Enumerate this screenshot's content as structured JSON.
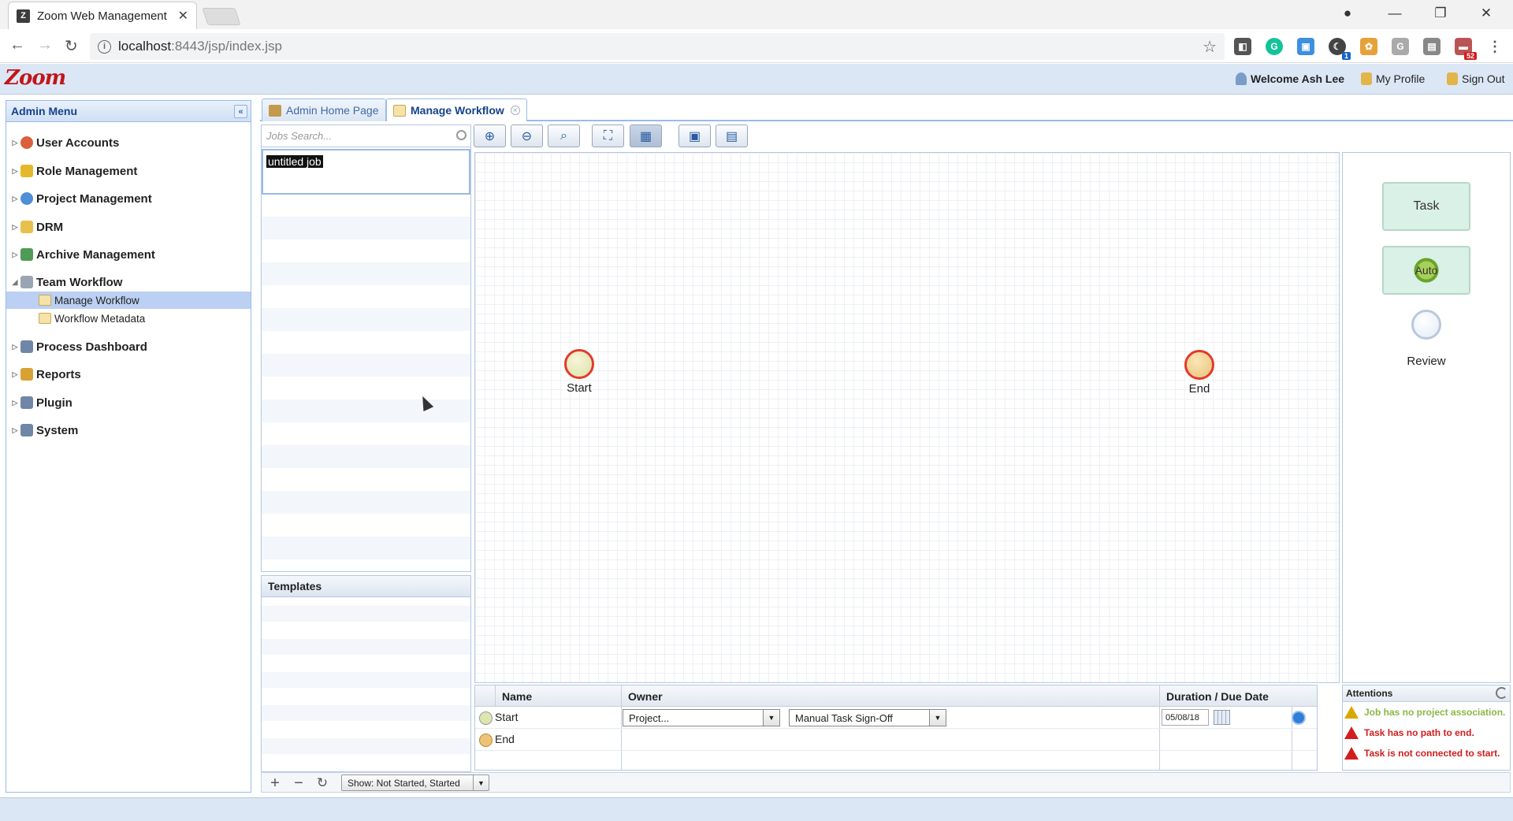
{
  "browser": {
    "tab_title": "Zoom Web Management",
    "favicon": "Z",
    "url_host": "localhost",
    "url_path": ":8443/jsp/index.jsp",
    "ext_badge_1": "1",
    "ext_badge_52": "52"
  },
  "app": {
    "logo": "Zoom",
    "welcome": "Welcome Ash Lee",
    "my_profile": "My Profile",
    "sign_out": "Sign Out"
  },
  "sidebar": {
    "title": "Admin Menu",
    "items": [
      {
        "label": "User Accounts",
        "icon": "user-icon",
        "color": "#d9603b"
      },
      {
        "label": "Role Management",
        "icon": "shield-icon",
        "color": "#e5b82b"
      },
      {
        "label": "Project Management",
        "icon": "globe-icon",
        "color": "#4f8fd6"
      },
      {
        "label": "DRM",
        "icon": "folder-icon",
        "color": "#e8c14d"
      },
      {
        "label": "Archive Management",
        "icon": "archive-icon",
        "color": "#4f9b55"
      },
      {
        "label": "Team Workflow",
        "icon": "workflow-icon",
        "color": "#9aa5b4"
      },
      {
        "label": "Process Dashboard",
        "icon": "monitor-icon",
        "color": "#6f86a6"
      },
      {
        "label": "Reports",
        "icon": "reports-icon",
        "color": "#d8a233"
      },
      {
        "label": "Plugin",
        "icon": "monitor-icon",
        "color": "#6f86a6"
      },
      {
        "label": "System",
        "icon": "monitor-icon",
        "color": "#6f86a6"
      }
    ],
    "sub_items": [
      {
        "label": "Manage Workflow"
      },
      {
        "label": "Workflow Metadata"
      }
    ]
  },
  "content_tabs": [
    {
      "label": "Admin Home Page",
      "icon": "home-icon"
    },
    {
      "label": "Manage Workflow",
      "icon": "workflow-icon"
    }
  ],
  "jobs": {
    "search_placeholder": "Jobs Search...",
    "selected_job": "untitled job"
  },
  "templates": {
    "title": "Templates"
  },
  "bottom": {
    "add": "+",
    "remove": "−",
    "filter": "Show: Not Started, Started"
  },
  "canvas": {
    "start_label": "Start",
    "end_label": "End"
  },
  "palette": {
    "task": "Task",
    "auto": "Auto",
    "review": "Review"
  },
  "task_table": {
    "headers": {
      "name": "Name",
      "owner": "Owner",
      "duration": "Duration / Due Date"
    },
    "rows": [
      {
        "name": "Start",
        "owner_select": "Project...",
        "signoff_select": "Manual Task Sign-Off",
        "date": "05/08/18"
      },
      {
        "name": "End"
      }
    ]
  },
  "attentions": {
    "title": "Attentions",
    "items": [
      {
        "text": "Job has no project association.",
        "color": "#8ab845",
        "level": "warning"
      },
      {
        "text": "Task has no path to end.",
        "color": "#d21d1d",
        "level": "error"
      },
      {
        "text": "Task is not connected to start.",
        "color": "#d21d1d",
        "level": "error"
      }
    ]
  }
}
